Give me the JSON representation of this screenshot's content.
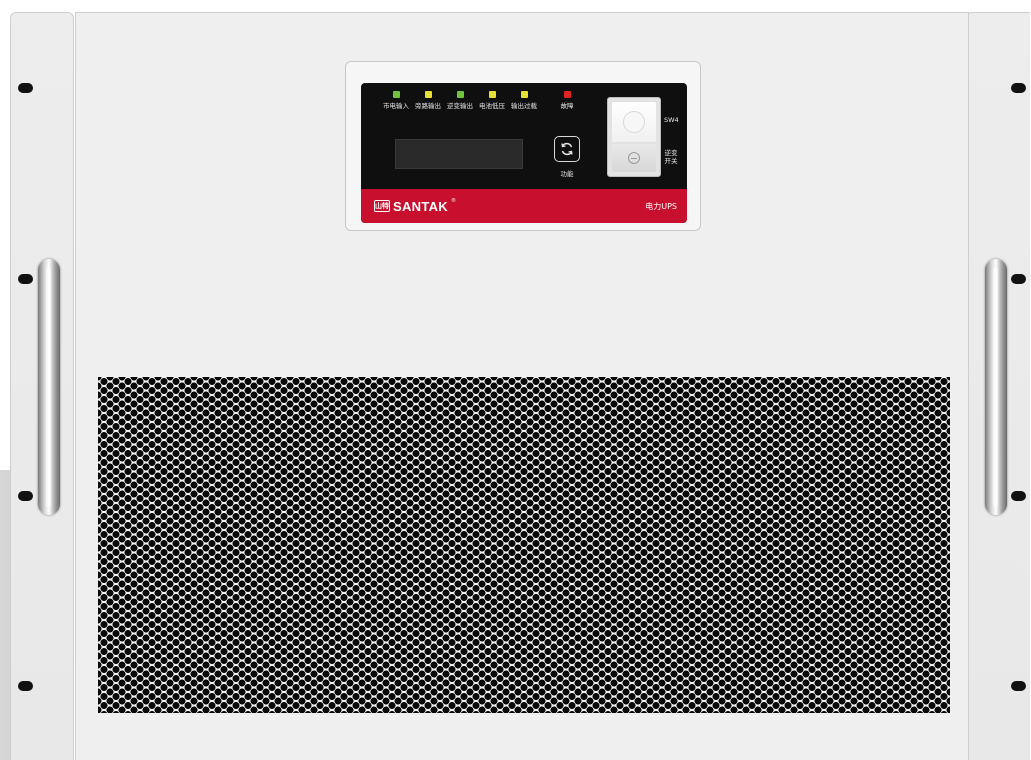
{
  "device": {
    "brand": "SANTAK",
    "brand_mark_text": "山特",
    "product_label": "电力UPS",
    "registered": "®"
  },
  "indicators": [
    {
      "label": "市电输入",
      "color": "#6ec43a"
    },
    {
      "label": "旁路输出",
      "color": "#e6e035"
    },
    {
      "label": "逆变输出",
      "color": "#6ec43a"
    },
    {
      "label": "电池低压",
      "color": "#e6e035"
    },
    {
      "label": "输出过载",
      "color": "#e6e035"
    },
    {
      "label": "故障",
      "color": "#e0241f"
    }
  ],
  "function_button": {
    "label": "功能"
  },
  "inverter_switch": {
    "id_label": "SW4",
    "name_line1": "逆变",
    "name_line2": "开关"
  },
  "colors": {
    "brand_red": "#c8102e",
    "panel_black": "#0f0f0f",
    "chassis": "#efefef"
  }
}
